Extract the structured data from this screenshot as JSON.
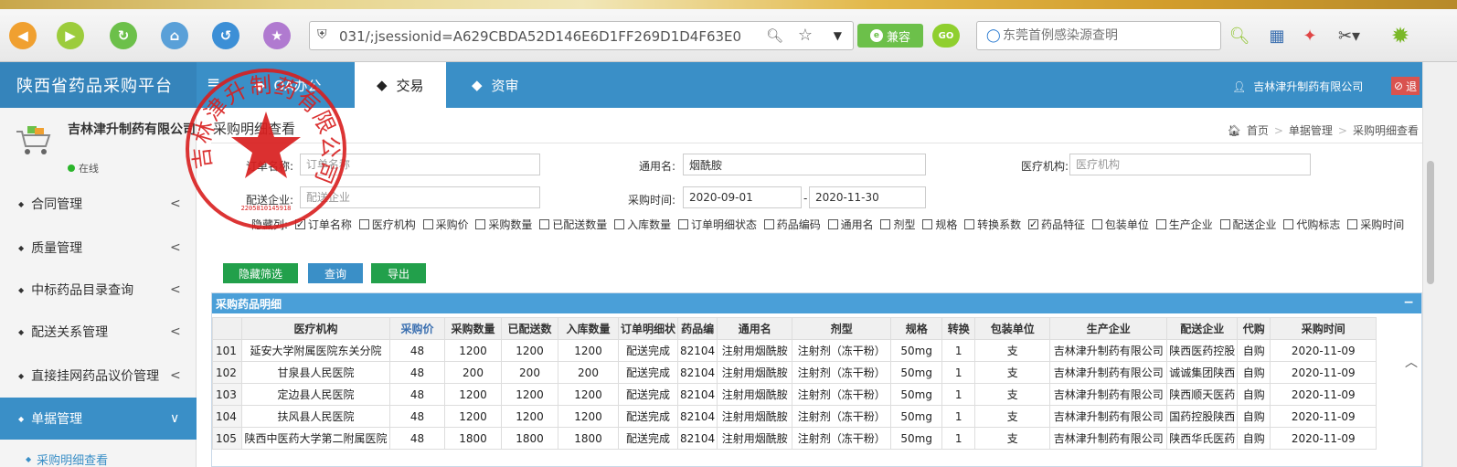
{
  "browser": {
    "url": "031/;jsessionid=A629CBDA52D146E6D1FF269D1D4F63E0",
    "compat_label": "兼容",
    "go_label": "GO",
    "search_placeholder": "东莞首例感染源查明"
  },
  "header": {
    "brand": "陕西省药品采购平台",
    "tabs": [
      {
        "label": "OA办公",
        "bullet": "◆"
      },
      {
        "label": "交易",
        "bullet": "◆"
      },
      {
        "label": "资审",
        "bullet": "◆"
      }
    ],
    "user": "吉林津升制药有限公司",
    "logout": "退出"
  },
  "sidebar": {
    "org": "吉林津升制药有限公司",
    "status": "在线",
    "items": [
      {
        "label": "合同管理",
        "chev": "<"
      },
      {
        "label": "质量管理",
        "chev": "<"
      },
      {
        "label": "中标药品目录查询",
        "chev": "<"
      },
      {
        "label": "配送关系管理",
        "chev": "<"
      },
      {
        "label": "直接挂网药品议价管理",
        "chev": "<"
      },
      {
        "label": "单据管理",
        "chev": "∨"
      }
    ],
    "sub_item": "采购明细查看"
  },
  "page": {
    "title": "采购明细查看",
    "breadcrumb": [
      "首页",
      "单据管理",
      "采购明细查看"
    ]
  },
  "filters": {
    "order_name_label": "订单名称:",
    "order_name_placeholder": "订单名称",
    "generic_label": "通用名:",
    "generic_value": "烟酰胺",
    "hospital_label": "医疗机构:",
    "hospital_placeholder": "医疗机构",
    "dist_label": "配送企业:",
    "dist_placeholder": "配送企业",
    "time_label": "采购时间:",
    "time_from": "2020-09-01",
    "time_dash": "-",
    "time_to": "2020-11-30"
  },
  "hidden_cols": {
    "label": "隐藏列:",
    "options": [
      {
        "label": "订单名称",
        "checked": true
      },
      {
        "label": "医疗机构",
        "checked": false
      },
      {
        "label": "采购价",
        "checked": false
      },
      {
        "label": "采购数量",
        "checked": false
      },
      {
        "label": "已配送数量",
        "checked": false
      },
      {
        "label": "入库数量",
        "checked": false
      },
      {
        "label": "订单明细状态",
        "checked": false
      },
      {
        "label": "药品编码",
        "checked": false
      },
      {
        "label": "通用名",
        "checked": false
      },
      {
        "label": "剂型",
        "checked": false
      },
      {
        "label": "规格",
        "checked": false
      },
      {
        "label": "转换系数",
        "checked": false
      },
      {
        "label": "药品特征",
        "checked": true
      },
      {
        "label": "包装单位",
        "checked": false
      },
      {
        "label": "生产企业",
        "checked": false
      },
      {
        "label": "配送企业",
        "checked": false
      },
      {
        "label": "代购标志",
        "checked": false
      },
      {
        "label": "采购时间",
        "checked": false
      }
    ]
  },
  "buttons": {
    "hide_filter": "隐藏筛选",
    "query": "查询",
    "export": "导出"
  },
  "grid": {
    "title": "采购药品明细",
    "collapse": "−",
    "columns": [
      "",
      "医疗机构",
      "采购价",
      "采购数量",
      "已配送数",
      "入库数量",
      "订单明细状",
      "药品编",
      "通用名",
      "剂型",
      "规格",
      "转换",
      "包装单位",
      "生产企业",
      "配送企业",
      "代购",
      "采购时间"
    ],
    "rows": [
      [
        "101",
        "延安大学附属医院东关分院",
        "48",
        "1200",
        "1200",
        "1200",
        "配送完成",
        "82104",
        "注射用烟酰胺",
        "注射剂（冻干粉）",
        "50mg",
        "1",
        "支",
        "吉林津升制药有限公司",
        "陕西医药控股",
        "自购",
        "2020-11-09"
      ],
      [
        "102",
        "甘泉县人民医院",
        "48",
        "200",
        "200",
        "200",
        "配送完成",
        "82104",
        "注射用烟酰胺",
        "注射剂（冻干粉）",
        "50mg",
        "1",
        "支",
        "吉林津升制药有限公司",
        "诚诚集团陕西",
        "自购",
        "2020-11-09"
      ],
      [
        "103",
        "定边县人民医院",
        "48",
        "1200",
        "1200",
        "1200",
        "配送完成",
        "82104",
        "注射用烟酰胺",
        "注射剂（冻干粉）",
        "50mg",
        "1",
        "支",
        "吉林津升制药有限公司",
        "陕西顺天医药",
        "自购",
        "2020-11-09"
      ],
      [
        "104",
        "扶风县人民医院",
        "48",
        "1200",
        "1200",
        "1200",
        "配送完成",
        "82104",
        "注射用烟酰胺",
        "注射剂（冻干粉）",
        "50mg",
        "1",
        "支",
        "吉林津升制药有限公司",
        "国药控股陕西",
        "自购",
        "2020-11-09"
      ],
      [
        "105",
        "陕西中医药大学第二附属医院",
        "48",
        "1800",
        "1800",
        "1800",
        "配送完成",
        "82104",
        "注射用烟酰胺",
        "注射剂（冻干粉）",
        "50mg",
        "1",
        "支",
        "吉林津升制药有限公司",
        "陕西华氏医药",
        "自购",
        "2020-11-09"
      ]
    ]
  },
  "stamp": {
    "text": "吉林津升制药有限公司",
    "digits": "2205810145918"
  },
  "colors": {
    "header_blue": "#3a8fc7",
    "green_button": "#22a04b",
    "stamp_red": "#d81e1e"
  }
}
